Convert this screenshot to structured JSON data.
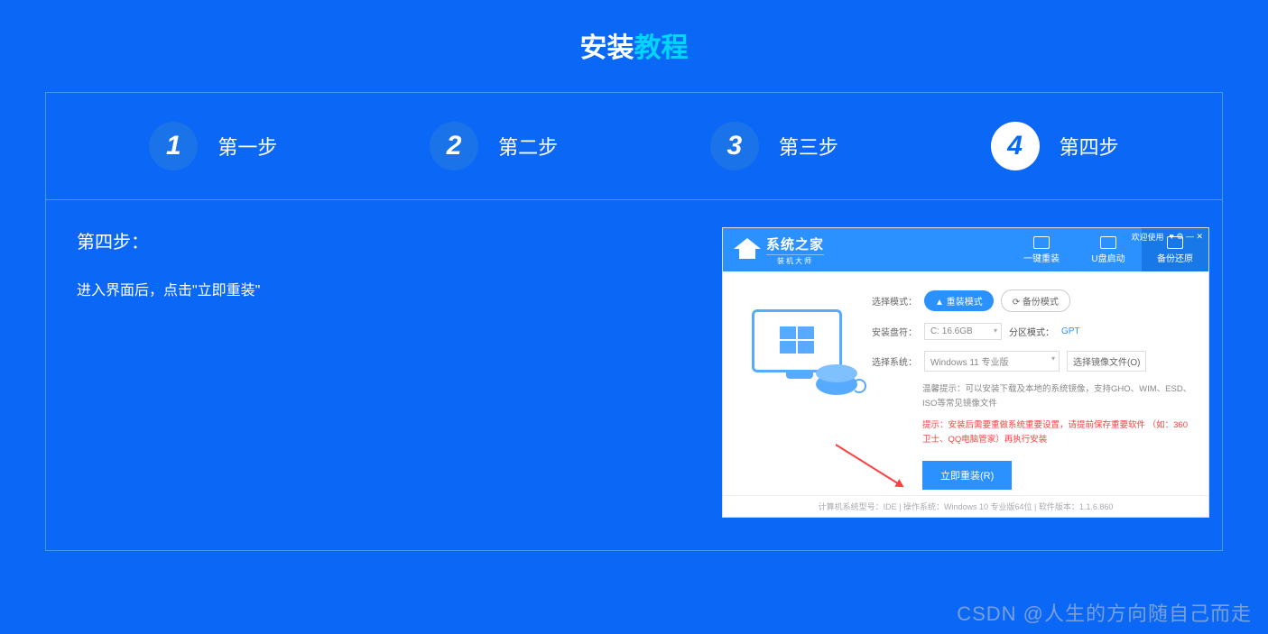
{
  "header": {
    "title_part1": "安装",
    "title_part2": "教程"
  },
  "steps": [
    {
      "num": "1",
      "label": "第一步"
    },
    {
      "num": "2",
      "label": "第二步"
    },
    {
      "num": "3",
      "label": "第三步"
    },
    {
      "num": "4",
      "label": "第四步"
    }
  ],
  "content": {
    "title": "第四步：",
    "body": "进入界面后，点击\"立即重装\""
  },
  "app": {
    "logo_text": "系统之家",
    "logo_sub": "装机大师",
    "tabs": [
      {
        "label": "一键重装"
      },
      {
        "label": "U盘启动"
      },
      {
        "label": "备份还原"
      }
    ],
    "win_controls": {
      "help": "欢迎使用",
      "icons": "♥ ⚙ — ✕"
    },
    "mode_label": "选择模式：",
    "mode_install": "▲ 重装模式",
    "mode_backup": "⟳ 备份模式",
    "disk_label": "安装盘符：",
    "disk_value": "C: 16.6GB",
    "partition_label": "分区模式：",
    "partition_value": "GPT",
    "system_label": "选择系统：",
    "system_value": "Windows 11 专业版",
    "browse_btn": "选择镜像文件(O)",
    "note": "温馨提示：可以安装下载及本地的系统镜像，支持GHO、WIM、ESD、ISO等常见镜像文件",
    "warn": "提示：安装后需要重做系统重要设置，请提前保存重要软件\n（如：360卫士、QQ电脑管家）再执行安装",
    "install_btn": "立即重装(R)",
    "footer": "计算机系统型号：IDE | 操作系统：Windows 10 专业版64位 | 软件版本：1.1.6.860"
  },
  "watermark": "CSDN @人生的方向随自己而走"
}
